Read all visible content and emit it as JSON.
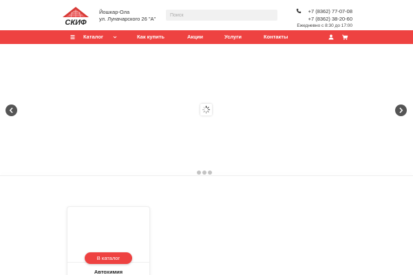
{
  "header": {
    "logo_text": "СКИФ",
    "address": {
      "city": "Йошкар-Ола",
      "street": "ул. Луначарского 26 \"А\""
    },
    "search": {
      "placeholder": "Поиск"
    },
    "contacts": {
      "phones": [
        "+7 (8362) 77-07-08",
        "+7 (8362) 38-20-60"
      ],
      "hours": "Ежедневно с 8:30 до 17:00"
    }
  },
  "nav": {
    "items": [
      {
        "label": "Каталог"
      },
      {
        "label": "Как купить"
      },
      {
        "label": "Акции"
      },
      {
        "label": "Услуги"
      },
      {
        "label": "Контакты"
      }
    ]
  },
  "slider": {
    "dot_count": 3
  },
  "category_card": {
    "button_label": "В каталог",
    "title": "Автохимия"
  },
  "colors": {
    "brand_red": "#ee4241",
    "arrow_gray": "#555555",
    "dot_gray": "#c4c4c4"
  },
  "icons": {
    "menu": "hamburger-icon",
    "dropdown": "chevron-down-icon",
    "user": "user-icon",
    "cart": "cart-icon",
    "phone": "phone-icon",
    "prev": "chevron-left-icon",
    "next": "chevron-right-icon",
    "loader": "spinner-icon"
  }
}
